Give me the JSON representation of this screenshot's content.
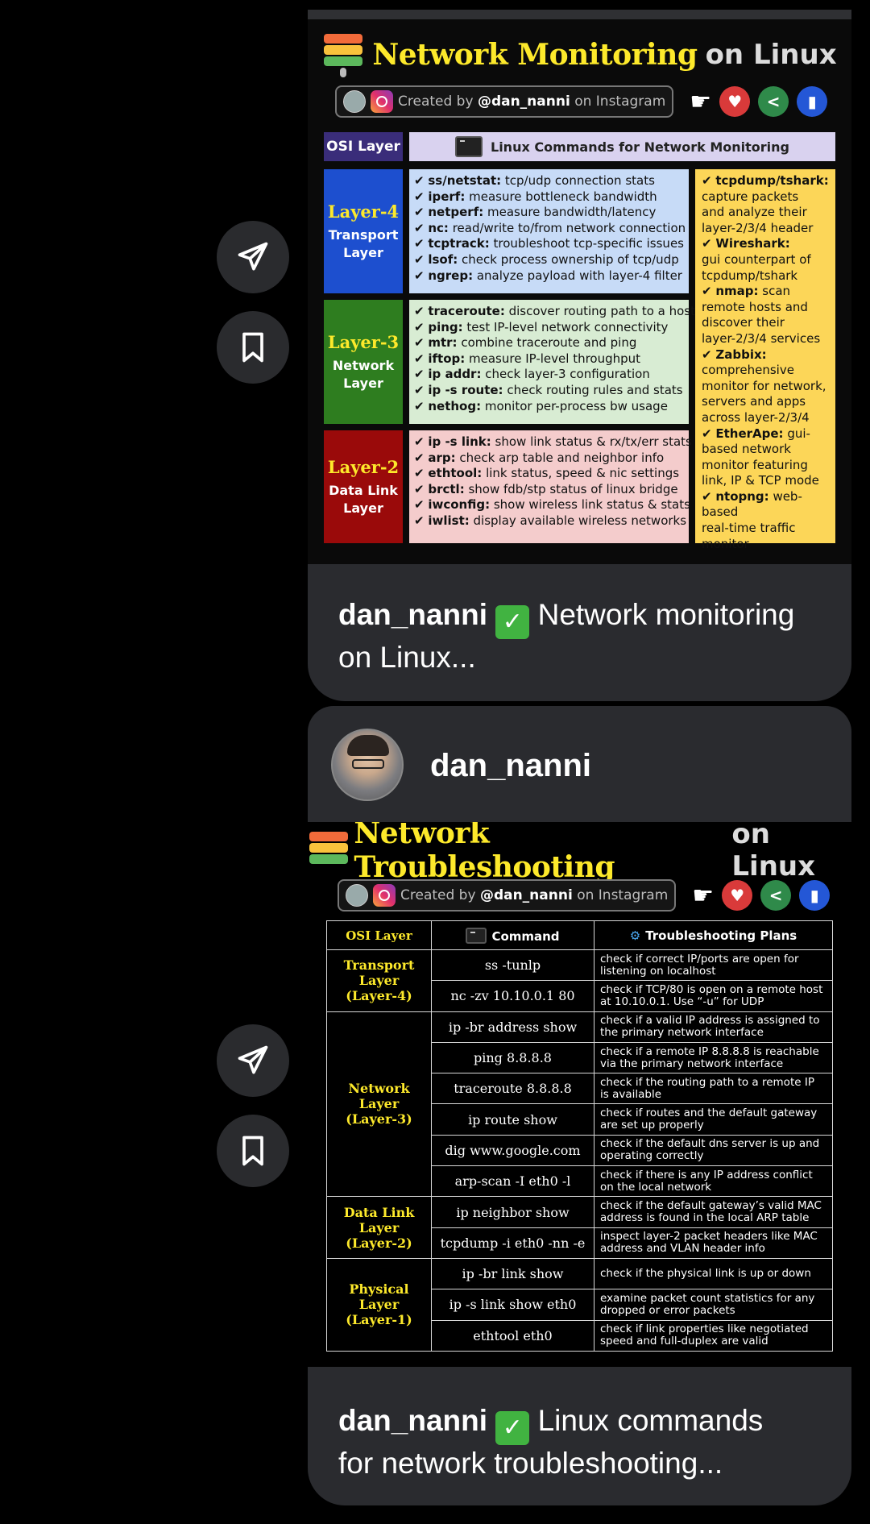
{
  "post1": {
    "title_main": "Network Monitoring",
    "title_sub": "on Linux",
    "credit_prefix": "Created by ",
    "credit_handle": "@dan_nanni",
    "credit_suffix": " on Instagram",
    "osi_header": "OSI Layer",
    "commands_header": "Linux Commands for Network Monitoring",
    "layers": [
      {
        "name": "Layer-4",
        "desc1": "Transport",
        "desc2": "Layer",
        "color": "#1d4fcf"
      },
      {
        "name": "Layer-3",
        "desc1": "Network",
        "desc2": "Layer",
        "color": "#2e7d1f"
      },
      {
        "name": "Layer-2",
        "desc1": "Data Link",
        "desc2": "Layer",
        "color": "#9a0a0a"
      }
    ],
    "layer4_cmds": [
      {
        "cmd": "ss/netstat:",
        "desc": " tcp/udp connection stats"
      },
      {
        "cmd": "iperf:",
        "desc": " measure bottleneck bandwidth"
      },
      {
        "cmd": "netperf:",
        "desc": " measure bandwidth/latency"
      },
      {
        "cmd": "nc:",
        "desc": " read/write to/from network connection"
      },
      {
        "cmd": "tcptrack:",
        "desc": " troubleshoot tcp-specific issues"
      },
      {
        "cmd": "lsof:",
        "desc": " check process ownership of tcp/udp"
      },
      {
        "cmd": "ngrep:",
        "desc": " analyze payload with layer-4 filter"
      }
    ],
    "layer3_cmds": [
      {
        "cmd": "traceroute:",
        "desc": " discover routing path to a host"
      },
      {
        "cmd": "ping:",
        "desc": " test IP-level network connectivity"
      },
      {
        "cmd": "mtr:",
        "desc": " combine traceroute and ping"
      },
      {
        "cmd": "iftop:",
        "desc": " measure IP-level throughput"
      },
      {
        "cmd": "ip addr:",
        "desc": " check layer-3 configuration"
      },
      {
        "cmd": "ip -s route:",
        "desc": " check routing rules and stats"
      },
      {
        "cmd": "nethog:",
        "desc": " monitor per-process bw usage"
      }
    ],
    "layer2_cmds": [
      {
        "cmd": "ip -s link:",
        "desc": " show link status & rx/tx/err stats"
      },
      {
        "cmd": "arp:",
        "desc": " check arp table and neighbor info"
      },
      {
        "cmd": "ethtool:",
        "desc": " link status, speed & nic settings"
      },
      {
        "cmd": "brctl:",
        "desc": " show fdb/stp status of linux bridge"
      },
      {
        "cmd": "iwconfig:",
        "desc": " show wireless link status & stats"
      },
      {
        "cmd": "iwlist:",
        "desc": " display available wireless networks"
      }
    ],
    "side_lines": [
      {
        "b": "tcpdump/tshark:",
        "t": ""
      },
      {
        "b": "",
        "t": "capture packets"
      },
      {
        "b": "",
        "t": "and analyze their"
      },
      {
        "b": "",
        "t": "layer-2/3/4 header"
      },
      {
        "b": "Wireshark:",
        "t": ""
      },
      {
        "b": "",
        "t": "gui counterpart of"
      },
      {
        "b": "",
        "t": "tcpdump/tshark"
      },
      {
        "b": "nmap:",
        "t": " scan"
      },
      {
        "b": "",
        "t": "remote hosts and"
      },
      {
        "b": "",
        "t": "discover their"
      },
      {
        "b": "",
        "t": "layer-2/3/4 services"
      },
      {
        "b": "Zabbix:",
        "t": ""
      },
      {
        "b": "",
        "t": "comprehensive"
      },
      {
        "b": "",
        "t": "monitor for network,"
      },
      {
        "b": "",
        "t": "servers and apps"
      },
      {
        "b": "",
        "t": "across layer-2/3/4"
      },
      {
        "b": "EtherApe:",
        "t": "  gui-"
      },
      {
        "b": "",
        "t": "based network"
      },
      {
        "b": "",
        "t": "monitor featuring"
      },
      {
        "b": "",
        "t": "link, IP & TCP mode"
      },
      {
        "b": "ntopng:",
        "t": " web-based"
      },
      {
        "b": "",
        "t": " real-time traffic"
      },
      {
        "b": "",
        "t": " monitor"
      }
    ],
    "check_mark": "✔"
  },
  "caption1": {
    "user": "dan_nanni",
    "check": "✓",
    "line1": " Network monitoring",
    "line2": "on Linux..."
  },
  "profile": {
    "username": "dan_nanni"
  },
  "post2": {
    "title_main": "Network Troubleshooting",
    "title_sub": "on Linux",
    "credit_prefix": "Created by ",
    "credit_handle": "@dan_nanni",
    "credit_suffix": " on Instagram",
    "headers": {
      "osi": "OSI Layer",
      "command": "Command",
      "plans": "Troubleshooting Plans"
    },
    "groups": [
      {
        "layer": [
          "Transport",
          "Layer",
          "(Layer-4)"
        ],
        "rows": [
          {
            "cmd": "ss -tunlp",
            "plan": "check if correct IP/ports are open for listening on localhost"
          },
          {
            "cmd": "nc -zv 10.10.0.1 80",
            "plan": "check if TCP/80 is open on a remote host at 10.10.0.1. Use “-u” for UDP"
          }
        ]
      },
      {
        "layer": [
          "Network",
          "Layer",
          "(Layer-3)"
        ],
        "rows": [
          {
            "cmd": "ip -br address show",
            "plan": "check if a valid IP address is assigned to the primary network interface"
          },
          {
            "cmd": "ping 8.8.8.8",
            "plan": "check if a remote IP 8.8.8.8 is reachable via the primary network interface"
          },
          {
            "cmd": "traceroute 8.8.8.8",
            "plan": "check if the routing path to a remote IP is available"
          },
          {
            "cmd": "ip route show",
            "plan": "check if routes and the default gateway are set up properly"
          },
          {
            "cmd": "dig www.google.com",
            "plan": "check if the default dns server is up and operating correctly"
          },
          {
            "cmd": "arp-scan -I eth0 -l",
            "plan": "check if there is any IP address conflict on the local network"
          }
        ]
      },
      {
        "layer": [
          "Data Link",
          "Layer",
          "(Layer-2)"
        ],
        "rows": [
          {
            "cmd": "ip neighbor show",
            "plan": "check if the default gateway’s valid MAC address is found in the local ARP table"
          },
          {
            "cmd": "tcpdump -i eth0 -nn -e",
            "plan": "inspect layer-2 packet headers like MAC address and VLAN header info"
          }
        ]
      },
      {
        "layer": [
          "Physical",
          "Layer",
          "(Layer-1)"
        ],
        "rows": [
          {
            "cmd": "ip -br link show",
            "plan": "check if the physical link is up or down"
          },
          {
            "cmd": "ip -s link show eth0",
            "plan": "examine packet count statistics for any dropped or error packets"
          },
          {
            "cmd": "ethtool eth0",
            "plan": "check if link properties like negotiated speed and full-duplex are valid"
          }
        ]
      }
    ]
  },
  "caption2": {
    "user": "dan_nanni",
    "check": "✓",
    "line1": " Linux commands",
    "line2": "for network troubleshooting..."
  },
  "icons": {
    "share": "paper-plane-icon",
    "save": "bookmark-icon",
    "hand": "pointing-hand-icon",
    "heart": "heart-icon",
    "share_small": "share-icon",
    "bookmark_small": "bookmark-icon"
  },
  "colors": {
    "accent_yellow": "#fde92b",
    "card_bg": "#2a2b2f",
    "check_green": "#41b341"
  }
}
